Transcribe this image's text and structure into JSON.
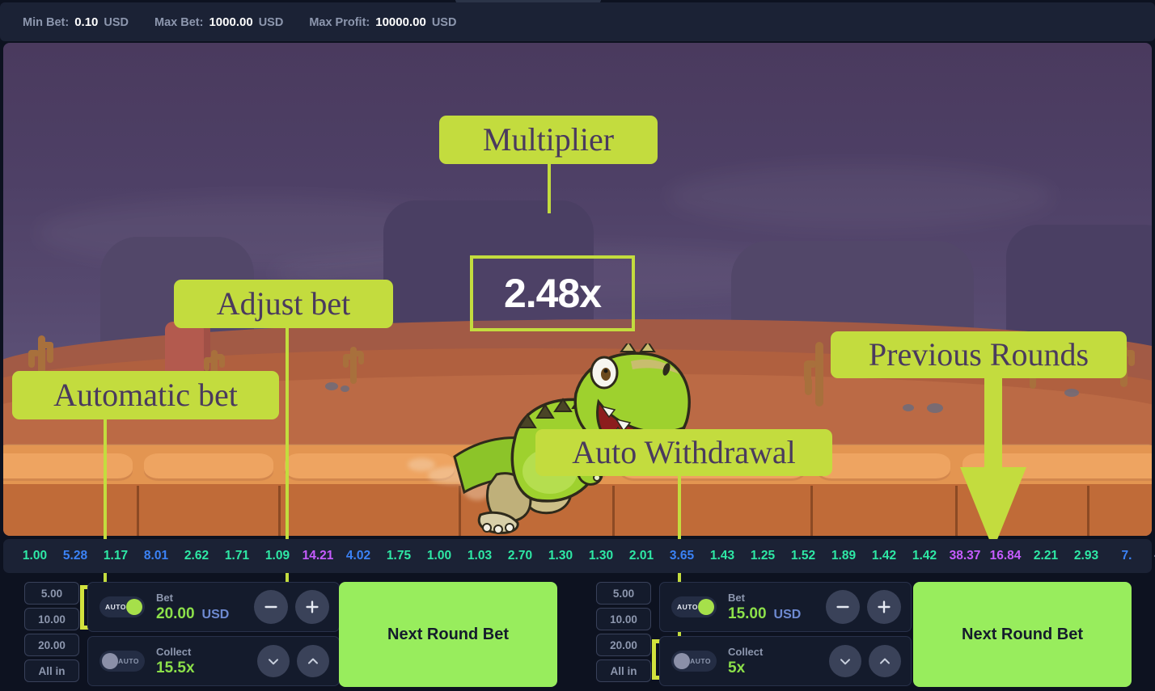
{
  "limits": [
    {
      "key": "Min Bet:",
      "value": "0.10",
      "unit": "USD"
    },
    {
      "key": "Max Bet:",
      "value": "1000.00",
      "unit": "USD"
    },
    {
      "key": "Max Profit:",
      "value": "10000.00",
      "unit": "USD"
    }
  ],
  "game": {
    "multiplier": "2.48x",
    "character": "running-trex"
  },
  "annotations": [
    {
      "id": "multiplier",
      "label": "Multiplier"
    },
    {
      "id": "adjust-bet",
      "label": "Adjust bet"
    },
    {
      "id": "automatic-bet",
      "label": "Automatic bet"
    },
    {
      "id": "auto-withdrawal",
      "label": "Auto Withdrawal"
    },
    {
      "id": "previous-rounds",
      "label": "Previous Rounds"
    }
  ],
  "annotation_color": "#c3dc3e",
  "annotation_text_color": "#4a3a5e",
  "history": {
    "expand_icon": "arrow-up-icon",
    "colors": {
      "low": "#2ee8a5",
      "mid": "#3b82f6",
      "high": "#c65cff"
    },
    "rounds": [
      {
        "value": "1.00",
        "tier": "low"
      },
      {
        "value": "5.28",
        "tier": "mid"
      },
      {
        "value": "1.17",
        "tier": "low"
      },
      {
        "value": "8.01",
        "tier": "mid"
      },
      {
        "value": "2.62",
        "tier": "low"
      },
      {
        "value": "1.71",
        "tier": "low"
      },
      {
        "value": "1.09",
        "tier": "low"
      },
      {
        "value": "14.21",
        "tier": "high"
      },
      {
        "value": "4.02",
        "tier": "mid"
      },
      {
        "value": "1.75",
        "tier": "low"
      },
      {
        "value": "1.00",
        "tier": "low"
      },
      {
        "value": "1.03",
        "tier": "low"
      },
      {
        "value": "2.70",
        "tier": "low"
      },
      {
        "value": "1.30",
        "tier": "low"
      },
      {
        "value": "1.30",
        "tier": "low"
      },
      {
        "value": "2.01",
        "tier": "low"
      },
      {
        "value": "3.65",
        "tier": "mid"
      },
      {
        "value": "1.43",
        "tier": "low"
      },
      {
        "value": "1.25",
        "tier": "low"
      },
      {
        "value": "1.52",
        "tier": "low"
      },
      {
        "value": "1.89",
        "tier": "low"
      },
      {
        "value": "1.42",
        "tier": "low"
      },
      {
        "value": "1.42",
        "tier": "low"
      },
      {
        "value": "38.37",
        "tier": "high"
      },
      {
        "value": "16.84",
        "tier": "high"
      },
      {
        "value": "2.21",
        "tier": "low"
      },
      {
        "value": "2.93",
        "tier": "low"
      },
      {
        "value": "7.",
        "tier": "mid"
      }
    ]
  },
  "panels": {
    "left": {
      "quick_bets": [
        "5.00",
        "10.00",
        "20.00",
        "All in"
      ],
      "bet": {
        "label": "Bet",
        "value": "20.00",
        "currency": "USD",
        "auto_label": "AUTO",
        "auto_on": true,
        "minus": "−",
        "plus": "+"
      },
      "collect": {
        "label": "Collect",
        "value": "15.5x",
        "auto_label": "AUTO",
        "auto_on": false,
        "down": "⌄",
        "up": "⌃"
      },
      "action_button": "Next Round Bet"
    },
    "right": {
      "quick_bets": [
        "5.00",
        "10.00",
        "20.00",
        "All in"
      ],
      "bet": {
        "label": "Bet",
        "value": "15.00",
        "currency": "USD",
        "auto_label": "AUTO",
        "auto_on": true,
        "minus": "−",
        "plus": "+"
      },
      "collect": {
        "label": "Collect",
        "value": "5x",
        "auto_label": "AUTO",
        "auto_on": false,
        "down": "⌄",
        "up": "⌃"
      },
      "action_button": "Next Round Bet"
    }
  }
}
